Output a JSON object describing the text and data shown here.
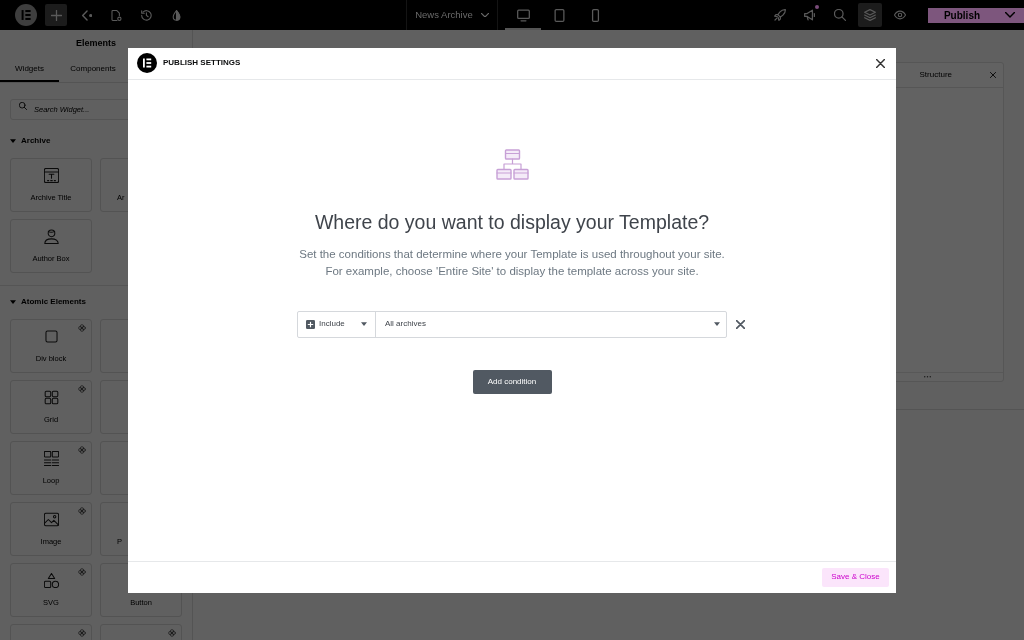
{
  "top_bar": {
    "left_tools": [
      {
        "kind": "plus",
        "selected": true
      },
      {
        "kind": "angle-dot",
        "selected": false
      },
      {
        "kind": "document-gear",
        "selected": false
      },
      {
        "kind": "history",
        "selected": false
      },
      {
        "kind": "droplet",
        "selected": false
      }
    ],
    "document_title": "News Archive",
    "devices": [
      {
        "kind": "desktop",
        "selected": true
      },
      {
        "kind": "tablet",
        "selected": false
      },
      {
        "kind": "mobile",
        "selected": false
      }
    ],
    "right_tools": [
      {
        "kind": "rocket",
        "selected": false,
        "notification": false
      },
      {
        "kind": "megaphone",
        "selected": false,
        "notification": true
      },
      {
        "kind": "search",
        "selected": false,
        "notification": false
      },
      {
        "kind": "layers",
        "selected": true,
        "notification": false
      },
      {
        "kind": "eye",
        "selected": false,
        "notification": false
      }
    ],
    "publish_label": "Publish"
  },
  "elements_panel": {
    "title": "Elements",
    "tabs": [
      {
        "label": "Widgets",
        "selected": true
      },
      {
        "label": "Components",
        "selected": false
      }
    ],
    "search": {
      "placeholder": "Search Widget..."
    },
    "sections": [
      {
        "title": "Archive",
        "expanded": true,
        "widgets": [
          {
            "kind": "text-window",
            "label": "Archive Title",
            "label_cut": false,
            "corner_badge": false
          },
          {
            "label": "Ar",
            "label_cut": true
          },
          {
            "kind": "person",
            "label": "Author Box",
            "label_cut": false,
            "corner_badge": false
          }
        ]
      },
      {
        "title": "Atomic Elements",
        "expanded": true,
        "widgets": [
          {
            "kind": "square",
            "label": "Div block",
            "label_cut": false,
            "corner_badge": true
          },
          {
            "kind": "blank"
          },
          {
            "kind": "grid",
            "label": "Grid",
            "label_cut": false,
            "corner_badge": true
          },
          {
            "kind": "blank"
          },
          {
            "kind": "columns",
            "label": "Loop",
            "label_cut": false,
            "corner_badge": true
          },
          {
            "kind": "blank"
          },
          {
            "kind": "image",
            "label": "Image",
            "label_cut": false,
            "corner_badge": true
          },
          {
            "label": "P",
            "label_cut": true
          },
          {
            "kind": "shapes",
            "label": "SVG",
            "label_cut": false,
            "corner_badge": true
          },
          {
            "label": "Button",
            "label_cut": false
          },
          {
            "corner_badge": true
          },
          {
            "corner_badge": true
          }
        ]
      }
    ]
  },
  "structure_panel": {
    "title": "Structure"
  },
  "publish_modal": {
    "title": "PUBLISH SETTINGS",
    "heading": "Where do you want to display your Template?",
    "description": [
      "Set the conditions that determine where your Template is used throughout your site.",
      "For example, choose 'Entire Site' to display the template across your site."
    ],
    "conditions": [
      {
        "kind": "include",
        "type_label": "Include",
        "value": "All archives"
      }
    ],
    "add_button": "Add condition",
    "save_button": "Save & Close"
  }
}
